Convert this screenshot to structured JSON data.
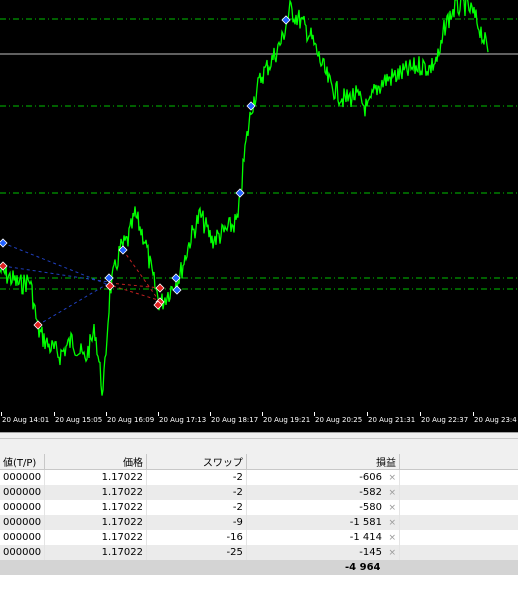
{
  "chart": {
    "time_labels": [
      "20 Aug 14:01",
      "20 Aug 15:05",
      "20 Aug 16:09",
      "20 Aug 17:13",
      "20 Aug 18:17",
      "20 Aug 19:21",
      "20 Aug 20:25",
      "20 Aug 21:31",
      "20 Aug 22:37",
      "20 Aug 23:4"
    ],
    "colors": {
      "background": "#000000",
      "price_line": "#00ff00",
      "order_level": "#00c000",
      "current_price": "#c0c0c0",
      "buy_arrow": "#2060ff",
      "sell_arrow": "#e02020",
      "buy_trade_line": "#2040c0",
      "sell_trade_line": "#c02020"
    }
  },
  "table": {
    "headers": {
      "tp": "値(T/P)",
      "price": "価格",
      "swap": "スワップ",
      "profit": "損益"
    },
    "rows": [
      {
        "tp": "000000",
        "price": "1.17022",
        "swap": "-2",
        "profit": "-606"
      },
      {
        "tp": "000000",
        "price": "1.17022",
        "swap": "-2",
        "profit": "-582"
      },
      {
        "tp": "000000",
        "price": "1.17022",
        "swap": "-2",
        "profit": "-580"
      },
      {
        "tp": "000000",
        "price": "1.17022",
        "swap": "-9",
        "profit": "-1 581"
      },
      {
        "tp": "000000",
        "price": "1.17022",
        "swap": "-16",
        "profit": "-1 414"
      },
      {
        "tp": "000000",
        "price": "1.17022",
        "swap": "-25",
        "profit": "-145"
      }
    ],
    "close_glyph": "×",
    "total": "-4 964"
  }
}
